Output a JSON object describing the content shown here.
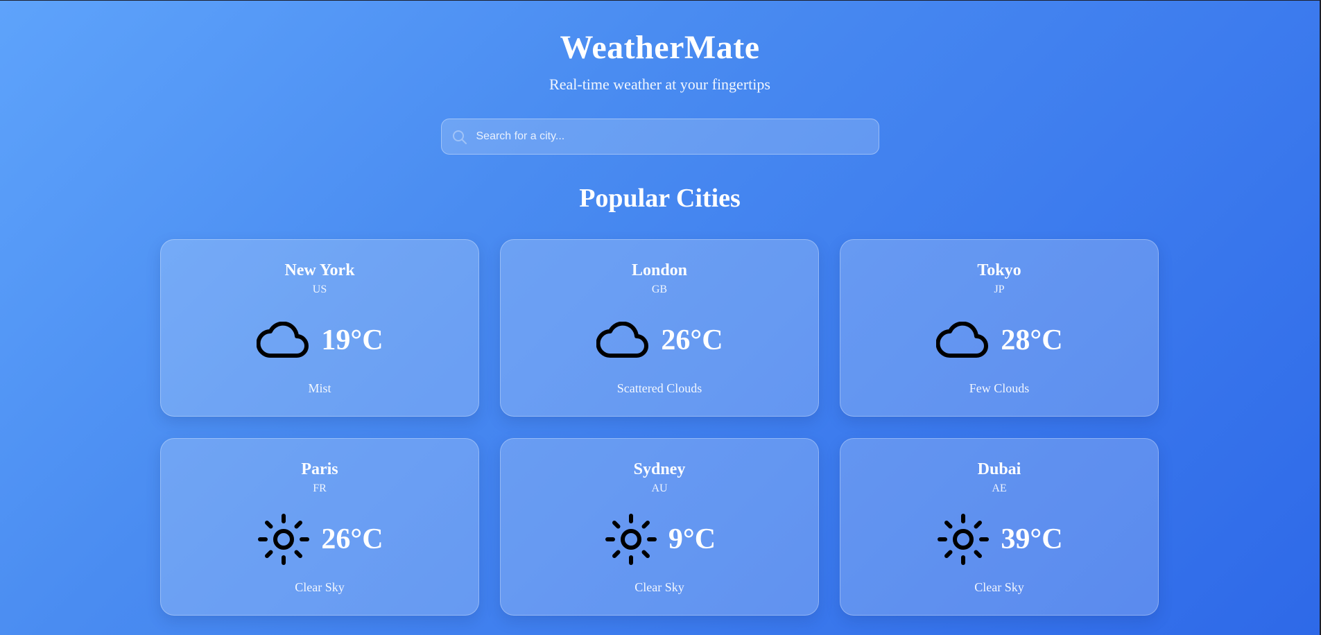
{
  "header": {
    "title": "WeatherMate",
    "subtitle": "Real-time weather at your fingertips"
  },
  "search": {
    "placeholder": "Search for a city...",
    "value": "",
    "icon": "search-icon"
  },
  "section": {
    "title": "Popular Cities"
  },
  "cities": [
    {
      "name": "New York",
      "country": "US",
      "temp": "19°C",
      "description": "Mist",
      "icon": "cloud-icon"
    },
    {
      "name": "London",
      "country": "GB",
      "temp": "26°C",
      "description": "Scattered Clouds",
      "icon": "cloud-icon"
    },
    {
      "name": "Tokyo",
      "country": "JP",
      "temp": "28°C",
      "description": "Few Clouds",
      "icon": "cloud-icon"
    },
    {
      "name": "Paris",
      "country": "FR",
      "temp": "26°C",
      "description": "Clear Sky",
      "icon": "sun-icon"
    },
    {
      "name": "Sydney",
      "country": "AU",
      "temp": "9°C",
      "description": "Clear Sky",
      "icon": "sun-icon"
    },
    {
      "name": "Dubai",
      "country": "AE",
      "temp": "39°C",
      "description": "Clear Sky",
      "icon": "sun-icon"
    }
  ],
  "colors": {
    "background_start": "#5ea3fb",
    "background_end": "#2e69e8",
    "text": "#ffffff",
    "icon_stroke": "#000000"
  }
}
